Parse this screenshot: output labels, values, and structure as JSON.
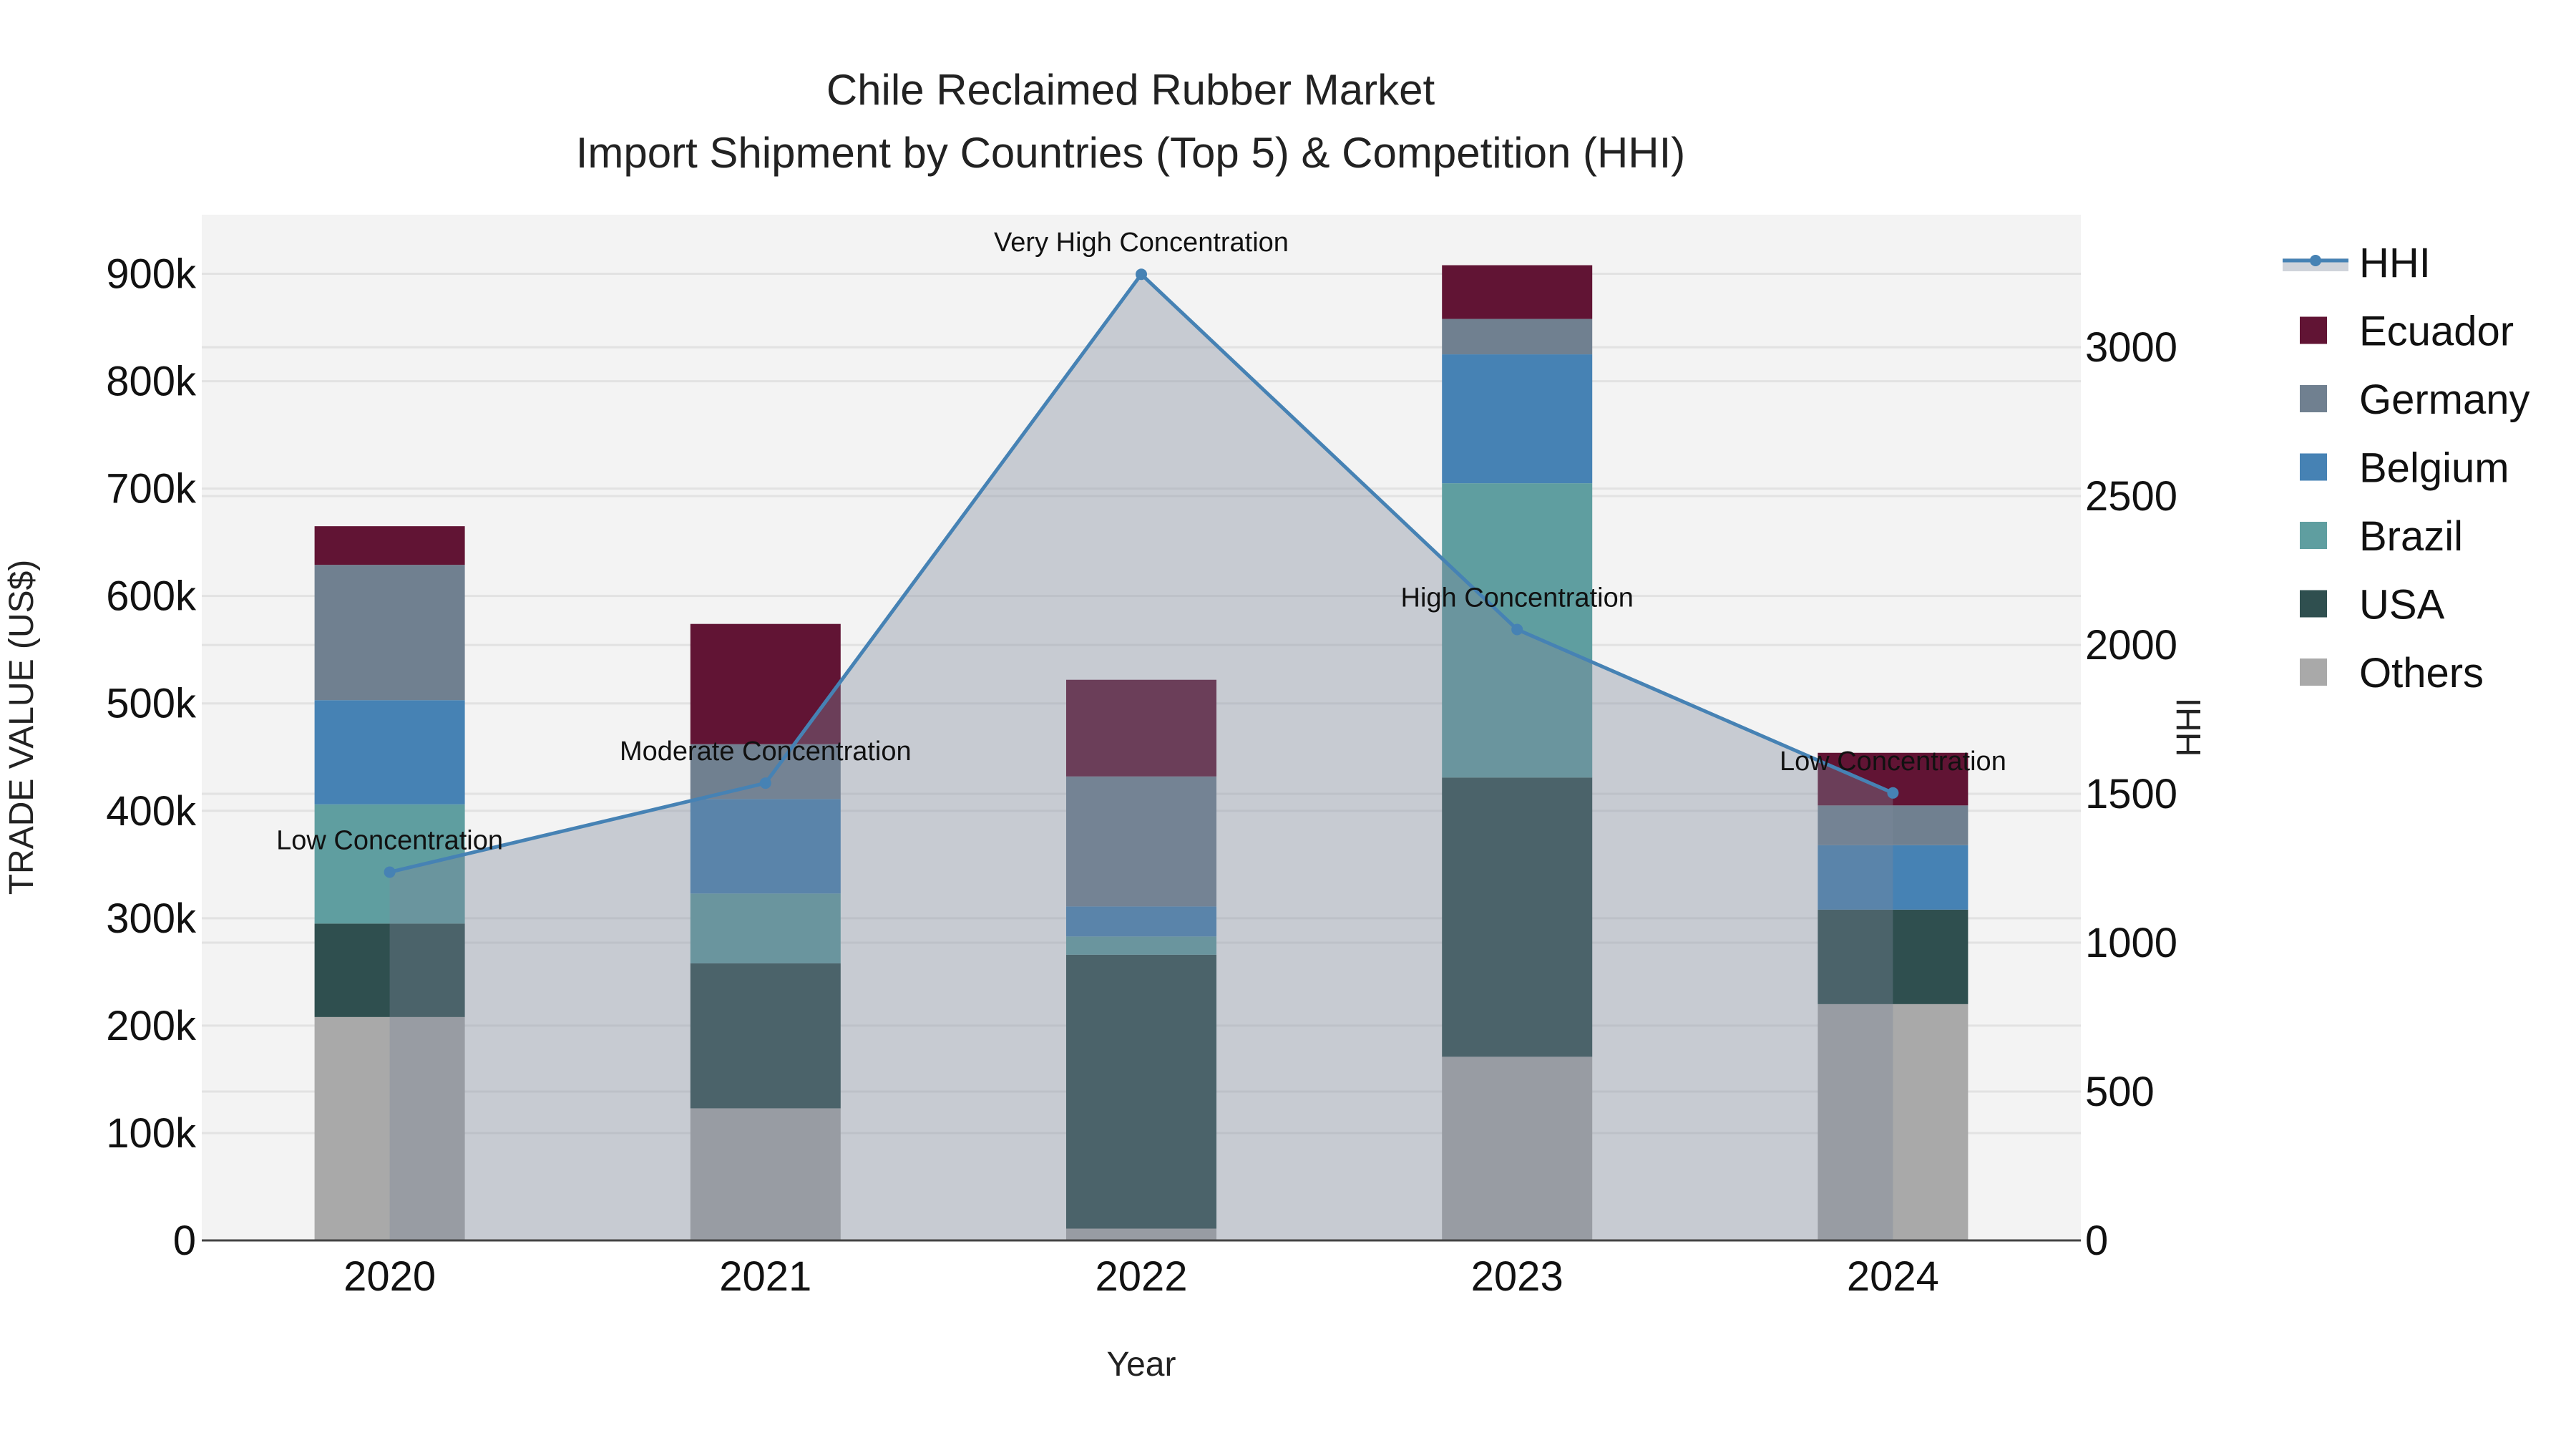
{
  "chart_data": {
    "type": "bar",
    "stacked": true,
    "title": "Chile Reclaimed Rubber Market",
    "subtitle": "Import Shipment by Countries (Top 5) & Competition (HHI)",
    "xlabel": "Year",
    "ylabel": "TRADE VALUE (US$)",
    "y2label": "HHI",
    "categories": [
      "2020",
      "2021",
      "2022",
      "2023",
      "2024"
    ],
    "ylim": [
      0,
      955000
    ],
    "y2lim": [
      0,
      3445
    ],
    "yticks": [
      0,
      100000,
      200000,
      300000,
      400000,
      500000,
      600000,
      700000,
      800000,
      900000
    ],
    "ytick_labels": [
      "0",
      "100k",
      "200k",
      "300k",
      "400k",
      "500k",
      "600k",
      "700k",
      "800k",
      "900k"
    ],
    "y2ticks": [
      0,
      500,
      1000,
      1500,
      2000,
      2500,
      3000
    ],
    "y2tick_labels": [
      "0",
      "500",
      "1000",
      "1500",
      "2000",
      "2500",
      "3000"
    ],
    "grid": true,
    "legend_position": "right",
    "series": [
      {
        "name": "Others",
        "color": "#a9a9a9",
        "values": [
          208000,
          123000,
          11000,
          171000,
          220000
        ]
      },
      {
        "name": "USA",
        "color": "#2f4f4f",
        "values": [
          87000,
          135000,
          255000,
          260000,
          88000
        ]
      },
      {
        "name": "Brazil",
        "color": "#5f9ea0",
        "values": [
          111000,
          65000,
          17000,
          274000,
          0
        ]
      },
      {
        "name": "Belgium",
        "color": "#4682b4",
        "values": [
          97000,
          88000,
          28000,
          120000,
          60000
        ]
      },
      {
        "name": "Germany",
        "color": "#708090",
        "values": [
          126000,
          51000,
          121000,
          33000,
          37000
        ]
      },
      {
        "name": "Ecuador",
        "color": "#611434",
        "values": [
          36000,
          112000,
          90000,
          50000,
          49000
        ]
      }
    ],
    "hhi": {
      "name": "HHI",
      "type": "line+area",
      "axis": "right",
      "color": "#4682b4",
      "values": [
        1237,
        1536,
        3245,
        2052,
        1503
      ],
      "annotations": [
        "Low Concentration",
        "Moderate Concentration",
        "Very High Concentration",
        "High Concentration",
        "Low Concentration"
      ]
    },
    "legend_order": [
      "HHI",
      "Ecuador",
      "Germany",
      "Belgium",
      "Brazil",
      "USA",
      "Others"
    ]
  }
}
